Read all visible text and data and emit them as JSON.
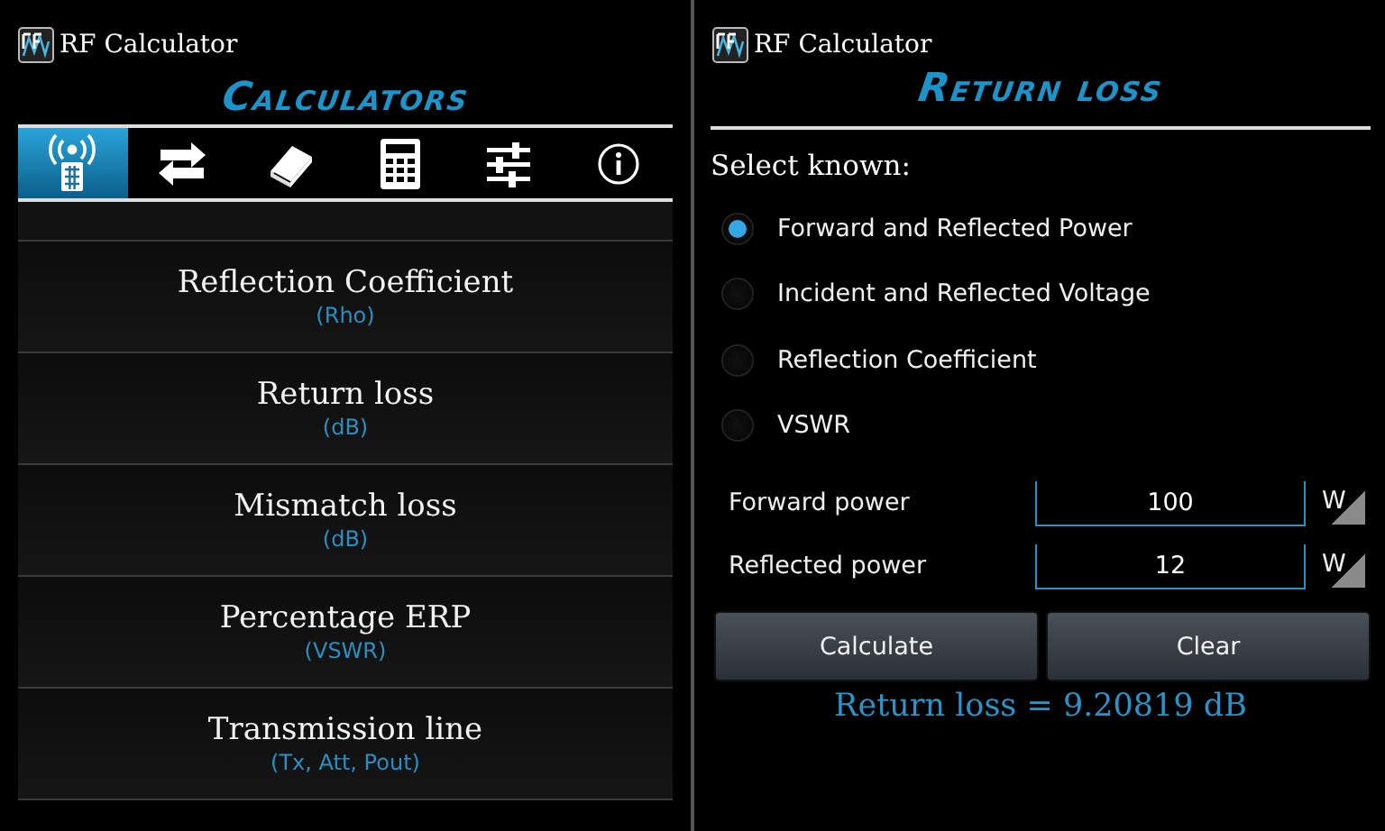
{
  "left_screen": {
    "app_title": "RF Calculator",
    "heading": "Calculators",
    "tabs": [
      {
        "kind": "antenna",
        "selected": true
      },
      {
        "kind": "arrows",
        "selected": false
      },
      {
        "kind": "book",
        "selected": false
      },
      {
        "kind": "calculator",
        "selected": false
      },
      {
        "kind": "sliders",
        "selected": false
      },
      {
        "kind": "info",
        "selected": false
      }
    ],
    "items": [
      {
        "title": "Reflection Coefficient",
        "subtitle": "(Rho)"
      },
      {
        "title": "Return loss",
        "subtitle": "(dB)"
      },
      {
        "title": "Mismatch loss",
        "subtitle": "(dB)"
      },
      {
        "title": "Percentage ERP",
        "subtitle": "(VSWR)"
      },
      {
        "title": "Transmission line",
        "subtitle": "(Tx, Att, Pout)"
      }
    ]
  },
  "right_screen": {
    "app_title": "RF Calculator",
    "heading": "Return loss",
    "prompt": "Select known:",
    "options": [
      {
        "label": "Forward and Reflected Power",
        "selected": true
      },
      {
        "label": "Incident and Reflected Voltage",
        "selected": false
      },
      {
        "label": "Reflection Coefficient",
        "selected": false
      },
      {
        "label": "VSWR",
        "selected": false
      }
    ],
    "fields": [
      {
        "label": "Forward power",
        "value": "100",
        "unit": "W"
      },
      {
        "label": "Reflected power",
        "value": "12",
        "unit": "W"
      }
    ],
    "buttons": [
      "Calculate",
      "Clear"
    ],
    "result": "Return loss = 9.20819 dB"
  }
}
